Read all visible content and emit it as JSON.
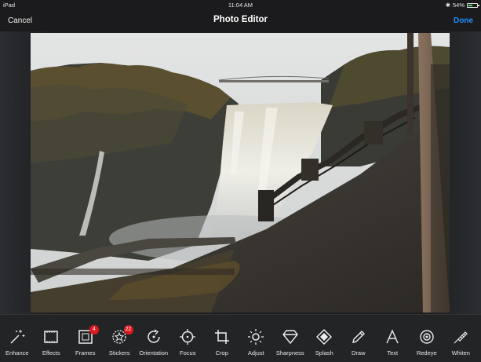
{
  "status": {
    "device": "iPad",
    "time": "11:04 AM",
    "battery": "54%",
    "battery_level": 0.54
  },
  "nav": {
    "cancel": "Cancel",
    "title": "Photo Editor",
    "done": "Done"
  },
  "colors": {
    "accent": "#1e90ff",
    "badge": "#e0191f"
  },
  "tools": [
    {
      "label": "Enhance",
      "icon": "magic-wand-icon"
    },
    {
      "label": "Effects",
      "icon": "film-icon"
    },
    {
      "label": "Frames",
      "icon": "frame-icon",
      "badge": "4"
    },
    {
      "label": "Stickers",
      "icon": "star-sticker-icon",
      "badge": "22"
    },
    {
      "label": "Orientation",
      "icon": "rotate-icon"
    },
    {
      "label": "Focus",
      "icon": "focus-icon"
    },
    {
      "label": "Crop",
      "icon": "crop-icon"
    },
    {
      "label": "Adjust",
      "icon": "sun-icon"
    },
    {
      "label": "Sharpness",
      "icon": "diamond-icon"
    },
    {
      "label": "Splash",
      "icon": "splash-icon"
    },
    {
      "label": "Draw",
      "icon": "pencil-icon"
    },
    {
      "label": "Text",
      "icon": "text-icon"
    },
    {
      "label": "Redeye",
      "icon": "eye-icon"
    },
    {
      "label": "Whiten",
      "icon": "brush-icon"
    }
  ]
}
